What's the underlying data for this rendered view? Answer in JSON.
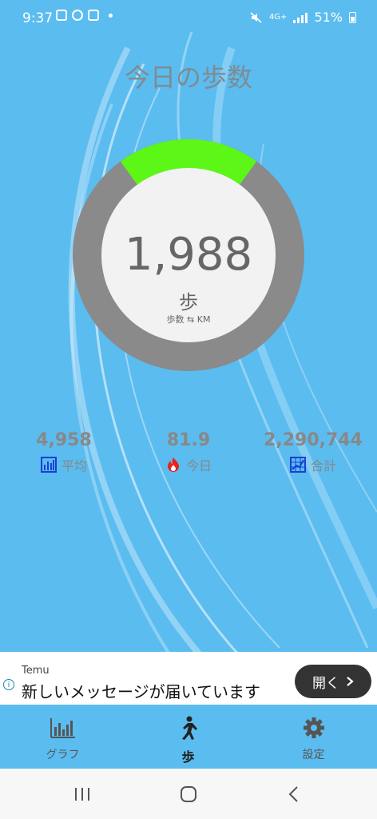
{
  "status_bar": {
    "time": "9:37",
    "battery": "51%",
    "network": "4G+"
  },
  "header": {
    "title": "今日の歩数"
  },
  "progress": {
    "steps": "1,988",
    "unit": "歩",
    "toggle_label": "歩数 ⇆ KM",
    "progress_fraction": 0.2
  },
  "stats": [
    {
      "value": "4,958",
      "label": "平均",
      "icon": "bar-chart-icon"
    },
    {
      "value": "81.9",
      "label": "今日",
      "icon": "flame-icon"
    },
    {
      "value": "2,290,744",
      "label": "合計",
      "icon": "grid-chart-icon"
    }
  ],
  "ad": {
    "brand": "Temu",
    "text": "新しいメッセージが届いています",
    "button_label": "開く"
  },
  "bottom_nav": [
    {
      "label": "グラフ",
      "icon": "graph-icon",
      "active": false
    },
    {
      "label": "歩",
      "icon": "walking-icon",
      "active": true
    },
    {
      "label": "設定",
      "icon": "settings-gear-icon",
      "active": false
    }
  ],
  "colors": {
    "background": "#5bbcf0",
    "ring_track": "#8a8a8a",
    "ring_progress": "#5cf716",
    "text_gray": "#888888",
    "ad_button": "#333333"
  }
}
